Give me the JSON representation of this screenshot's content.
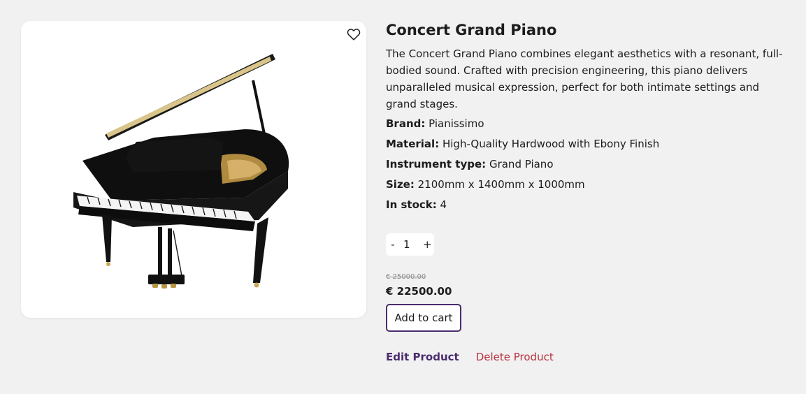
{
  "product": {
    "title": "Concert Grand Piano",
    "description": "The Concert Grand Piano combines elegant aesthetics with a resonant, full-bodied sound. Crafted with precision engineering, this piano delivers unparalleled musical expression, perfect for both intimate settings and grand stages.",
    "specs": [
      {
        "label": "Brand:",
        "value": "Pianissimo"
      },
      {
        "label": "Material:",
        "value": "High-Quality Hardwood with Ebony Finish"
      },
      {
        "label": "Instrument type:",
        "value": "Grand Piano"
      },
      {
        "label": "Size:",
        "value": "2100mm x 1400mm x 1000mm"
      },
      {
        "label": "In stock:",
        "value": "4"
      }
    ],
    "image_icon": "grand-piano-image"
  },
  "favorite": {
    "icon": "heart-outline-icon"
  },
  "quantity": {
    "minus": "-",
    "value": "1",
    "plus": "+"
  },
  "pricing": {
    "old_price": "€ 25000.00",
    "price": "€ 22500.00"
  },
  "actions": {
    "add_to_cart": "Add to cart",
    "edit": "Edit Product",
    "delete": "Delete Product"
  },
  "colors": {
    "accent": "#4a2c6e",
    "danger": "#b8323f",
    "background": "#f1f1f1"
  }
}
